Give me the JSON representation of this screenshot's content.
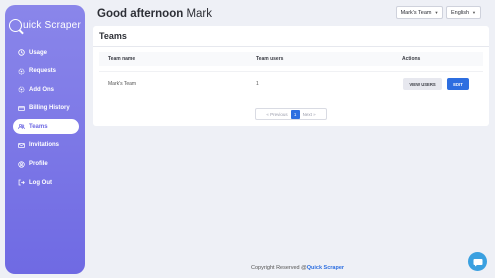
{
  "brand": {
    "logo_text": "uick Scraper"
  },
  "sidebar": {
    "items": [
      {
        "label": "Usage",
        "icon": "clock-icon",
        "active": false
      },
      {
        "label": "Requests",
        "icon": "gear-icon",
        "active": false
      },
      {
        "label": "Add Ons",
        "icon": "gear-icon",
        "active": false
      },
      {
        "label": "Billing History",
        "icon": "card-icon",
        "active": false
      },
      {
        "label": "Teams",
        "icon": "team-icon",
        "active": true
      },
      {
        "label": "Invitations",
        "icon": "mail-icon",
        "active": false
      },
      {
        "label": "Profile",
        "icon": "user-icon",
        "active": false
      },
      {
        "label": "Log Out",
        "icon": "logout-icon",
        "active": false
      }
    ]
  },
  "header": {
    "greeting": "Good afternoon",
    "user_name": "Mark",
    "team_select": "Mark's Team",
    "language_select": "English"
  },
  "teams": {
    "title": "Teams",
    "columns": [
      "Team name",
      "Team users",
      "Actions"
    ],
    "rows": [
      {
        "name": "Mark's Team",
        "users": "1",
        "view_label": "VIEW USERS",
        "edit_label": "EDIT"
      }
    ]
  },
  "pagination": {
    "previous": "« Previous",
    "current": "1",
    "next": "Next »"
  },
  "footer": {
    "prefix": "Copyright Reserved @",
    "brand": "Quick Scraper"
  },
  "colors": {
    "accent": "#6f6ae3",
    "primary_button": "#2d6ee0",
    "chat_bubble": "#3aa0e0"
  }
}
